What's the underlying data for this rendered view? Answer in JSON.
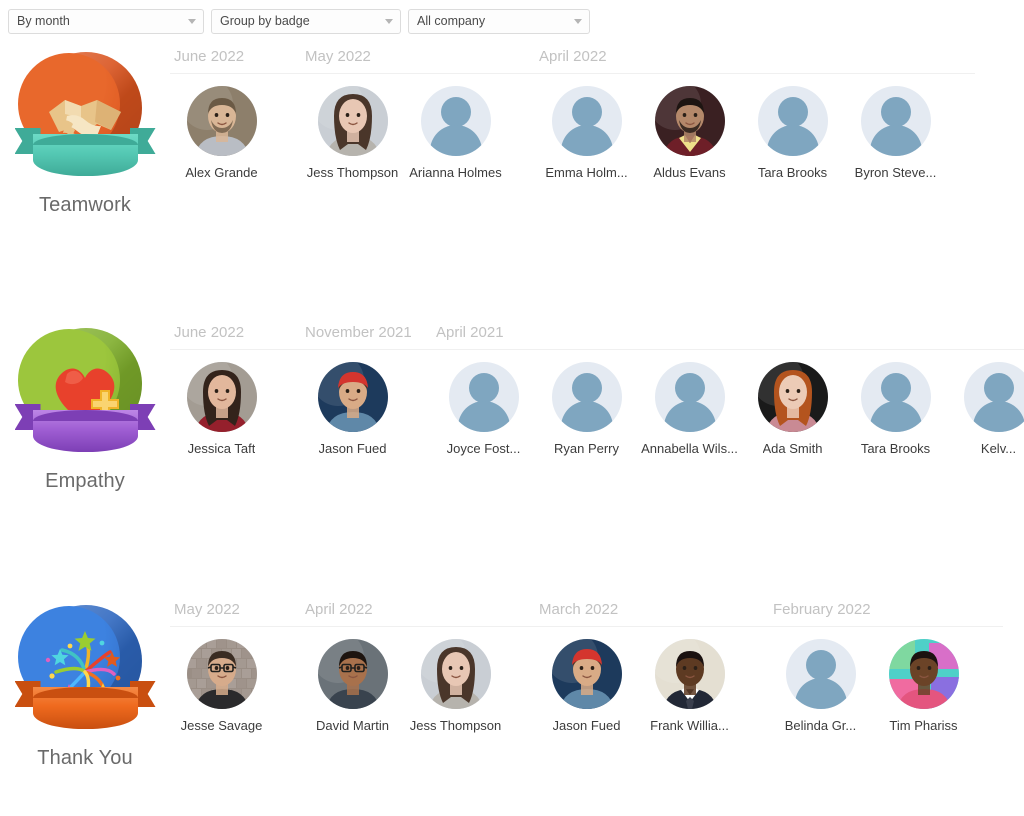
{
  "toolbar": {
    "filters": [
      {
        "name": "period-select",
        "value": "By month",
        "width": "w1"
      },
      {
        "name": "grouping-select",
        "value": "Group by badge",
        "width": "w2"
      },
      {
        "name": "scope-select",
        "value": "All company",
        "width": "w3"
      }
    ],
    "caret_icon": "chevron-down-icon"
  },
  "colors": {
    "teamwork_disc": "#e8682c",
    "teamwork_ribbon": "#55c9b4",
    "empathy_disc": "#9cc63d",
    "empathy_ribbon": "#a05fd4",
    "thankyou_disc": "#3d82e0",
    "thankyou_ribbon": "#ef6a1e",
    "placeholder_bg": "#e4eaf2",
    "placeholder_fg": "#7fa6c0",
    "month_text": "#c2c2c2",
    "name_text": "#3c3c3c",
    "badge_label": "#6a6a6a"
  },
  "rows": [
    {
      "badge": {
        "id": "teamwork",
        "label": "Teamwork",
        "icon": "handshake-icon"
      },
      "groups": [
        {
          "month": "June 2022",
          "people": [
            {
              "name": "Alex Grande",
              "avatar": "photo",
              "photo": "man-beard-outdoors"
            }
          ]
        },
        {
          "month": "May 2022",
          "people": [
            {
              "name": "Jess Thompson",
              "avatar": "photo",
              "photo": "woman-scarf"
            },
            {
              "name": "Arianna Holmes",
              "avatar": "placeholder"
            }
          ]
        },
        {
          "month": "April 2022",
          "people": [
            {
              "name": "Emma Holm...",
              "avatar": "placeholder"
            },
            {
              "name": "Aldus Evans",
              "avatar": "photo",
              "photo": "man-dark-hair"
            },
            {
              "name": "Tara Brooks",
              "avatar": "placeholder"
            },
            {
              "name": "Byron Steve...",
              "avatar": "placeholder"
            }
          ]
        }
      ]
    },
    {
      "badge": {
        "id": "empathy",
        "label": "Empathy",
        "icon": "heart-plus-icon"
      },
      "groups": [
        {
          "month": "June 2022",
          "people": [
            {
              "name": "Jessica Taft",
              "avatar": "photo",
              "photo": "woman-red-top"
            }
          ]
        },
        {
          "month": "November 2021",
          "people": [
            {
              "name": "Jason Fued",
              "avatar": "photo",
              "photo": "man-red-cap"
            }
          ]
        },
        {
          "month": "April 2021",
          "people": [
            {
              "name": "Joyce Fost...",
              "avatar": "placeholder"
            },
            {
              "name": "Ryan Perry",
              "avatar": "placeholder"
            },
            {
              "name": "Annabella Wils...",
              "avatar": "placeholder"
            },
            {
              "name": "Ada Smith",
              "avatar": "photo",
              "photo": "woman-redhead"
            },
            {
              "name": "Tara Brooks",
              "avatar": "placeholder"
            },
            {
              "name": "Kelv...",
              "avatar": "placeholder"
            }
          ]
        }
      ]
    },
    {
      "badge": {
        "id": "thankyou",
        "label": "Thank You",
        "icon": "fireworks-icon"
      },
      "groups": [
        {
          "month": "May 2022",
          "people": [
            {
              "name": "Jesse Savage",
              "avatar": "photo",
              "photo": "man-glasses-wall"
            }
          ]
        },
        {
          "month": "April 2022",
          "people": [
            {
              "name": "David Martin",
              "avatar": "photo",
              "photo": "man-glasses-smile"
            },
            {
              "name": "Jess Thompson",
              "avatar": "photo",
              "photo": "woman-scarf"
            }
          ]
        },
        {
          "month": "March 2022",
          "people": [
            {
              "name": "Jason Fued",
              "avatar": "photo",
              "photo": "man-red-cap"
            },
            {
              "name": "Frank Willia...",
              "avatar": "photo",
              "photo": "man-suit-tie"
            }
          ]
        },
        {
          "month": "February 2022",
          "people": [
            {
              "name": "Belinda Gr...",
              "avatar": "placeholder"
            },
            {
              "name": "Tim Phariss",
              "avatar": "photo",
              "photo": "man-colorful-wall"
            }
          ]
        }
      ]
    }
  ]
}
